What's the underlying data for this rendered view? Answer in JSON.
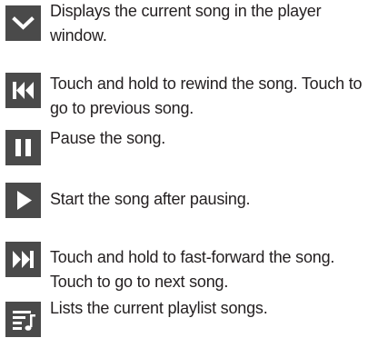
{
  "controls": [
    {
      "icon": "chevron-down-icon",
      "description": "Displays the current song in the player window."
    },
    {
      "icon": "skip-back-icon",
      "description": "Touch and hold to rewind the song. Touch to go to previous song."
    },
    {
      "icon": "pause-icon",
      "description": "Pause the song."
    },
    {
      "icon": "play-icon",
      "description": "Start the song after pausing."
    },
    {
      "icon": "skip-forward-icon",
      "description": "Touch and hold to fast-forward the song. Touch to go to next song."
    },
    {
      "icon": "playlist-icon",
      "description": "Lists the current playlist songs."
    }
  ],
  "colors": {
    "icon_background": "#4a4a4a",
    "icon_glyph": "#ffffff",
    "text": "#231f20"
  }
}
